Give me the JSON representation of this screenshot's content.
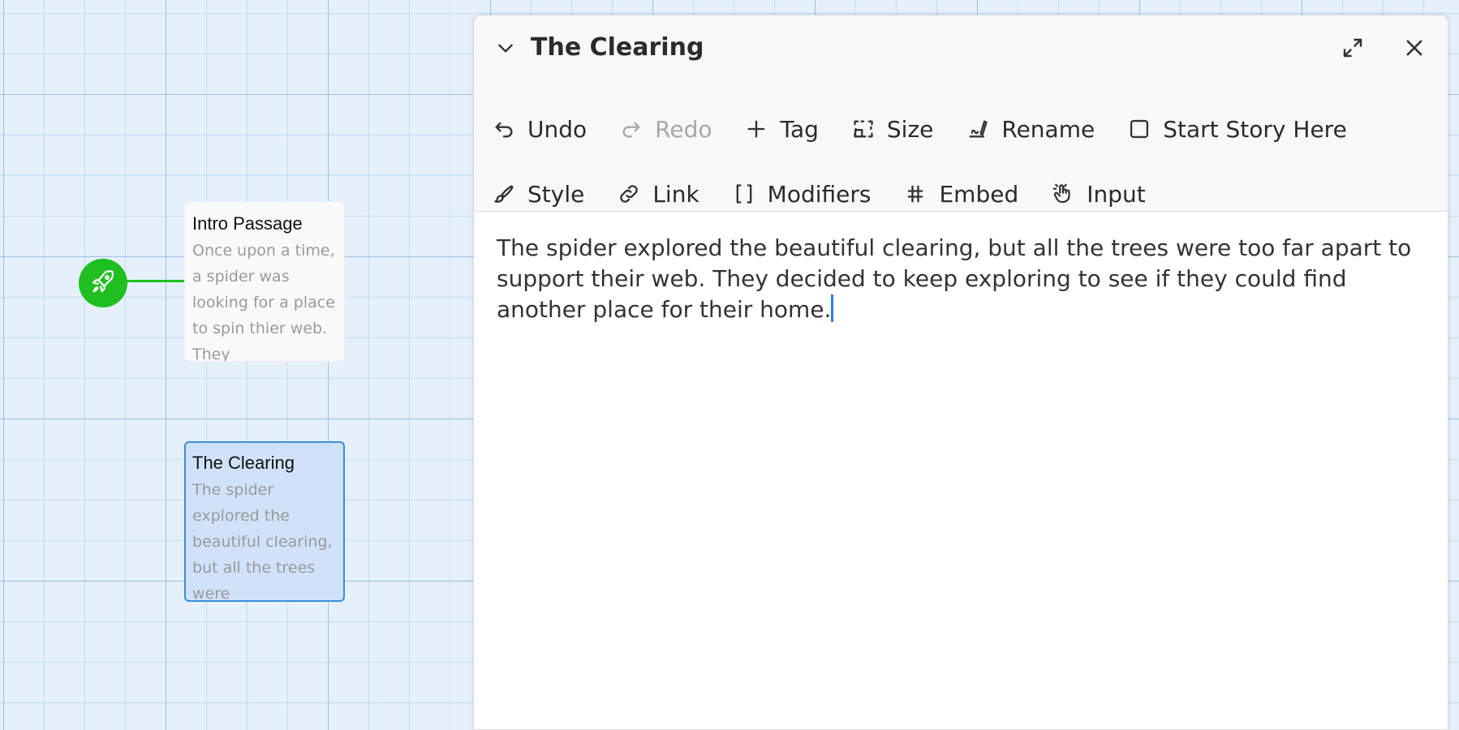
{
  "story_map": {
    "start_passage": {
      "badge_icon": "rocket-icon"
    },
    "passages": [
      {
        "title": "Intro Passage",
        "excerpt": "Once upon a time, a spider was looking for a place to spin thier web. They",
        "selected": false
      },
      {
        "title": "The Clearing",
        "excerpt": "The spider explored the beautiful clearing, but all the trees were",
        "selected": true
      }
    ]
  },
  "dialog": {
    "title": "The Clearing",
    "collapse_icon": "chevron-down-icon",
    "maximize_icon": "maximize-icon",
    "close_icon": "close-icon",
    "toolbar_row1": [
      {
        "label": "Undo",
        "icon": "undo-icon",
        "disabled": false
      },
      {
        "label": "Redo",
        "icon": "redo-icon",
        "disabled": true
      },
      {
        "label": "Tag",
        "icon": "plus-icon",
        "disabled": false
      },
      {
        "label": "Size",
        "icon": "size-icon",
        "disabled": false
      },
      {
        "label": "Rename",
        "icon": "rename-icon",
        "disabled": false
      },
      {
        "label": "Start Story Here",
        "icon": "checkbox-icon",
        "disabled": false
      }
    ],
    "toolbar_row2": [
      {
        "label": "Style",
        "icon": "brush-icon",
        "disabled": false
      },
      {
        "label": "Link",
        "icon": "link-icon",
        "disabled": false
      },
      {
        "label": "Modifiers",
        "icon": "brackets-icon",
        "disabled": false
      },
      {
        "label": "Embed",
        "icon": "hash-icon",
        "disabled": false
      },
      {
        "label": "Input",
        "icon": "tap-hand-icon",
        "disabled": false
      }
    ],
    "body_text": "The spider explored the beautiful clearing, but all the trees were too far apart to support their web. They decided to keep exploring to see if they could find another place for their home."
  },
  "colors": {
    "grid_background": "#e6f0fb",
    "start_green": "#1fbf1f",
    "selected_fill": "#cfe2f9",
    "selected_border": "#3b8de0",
    "caret": "#2f7fe0"
  }
}
